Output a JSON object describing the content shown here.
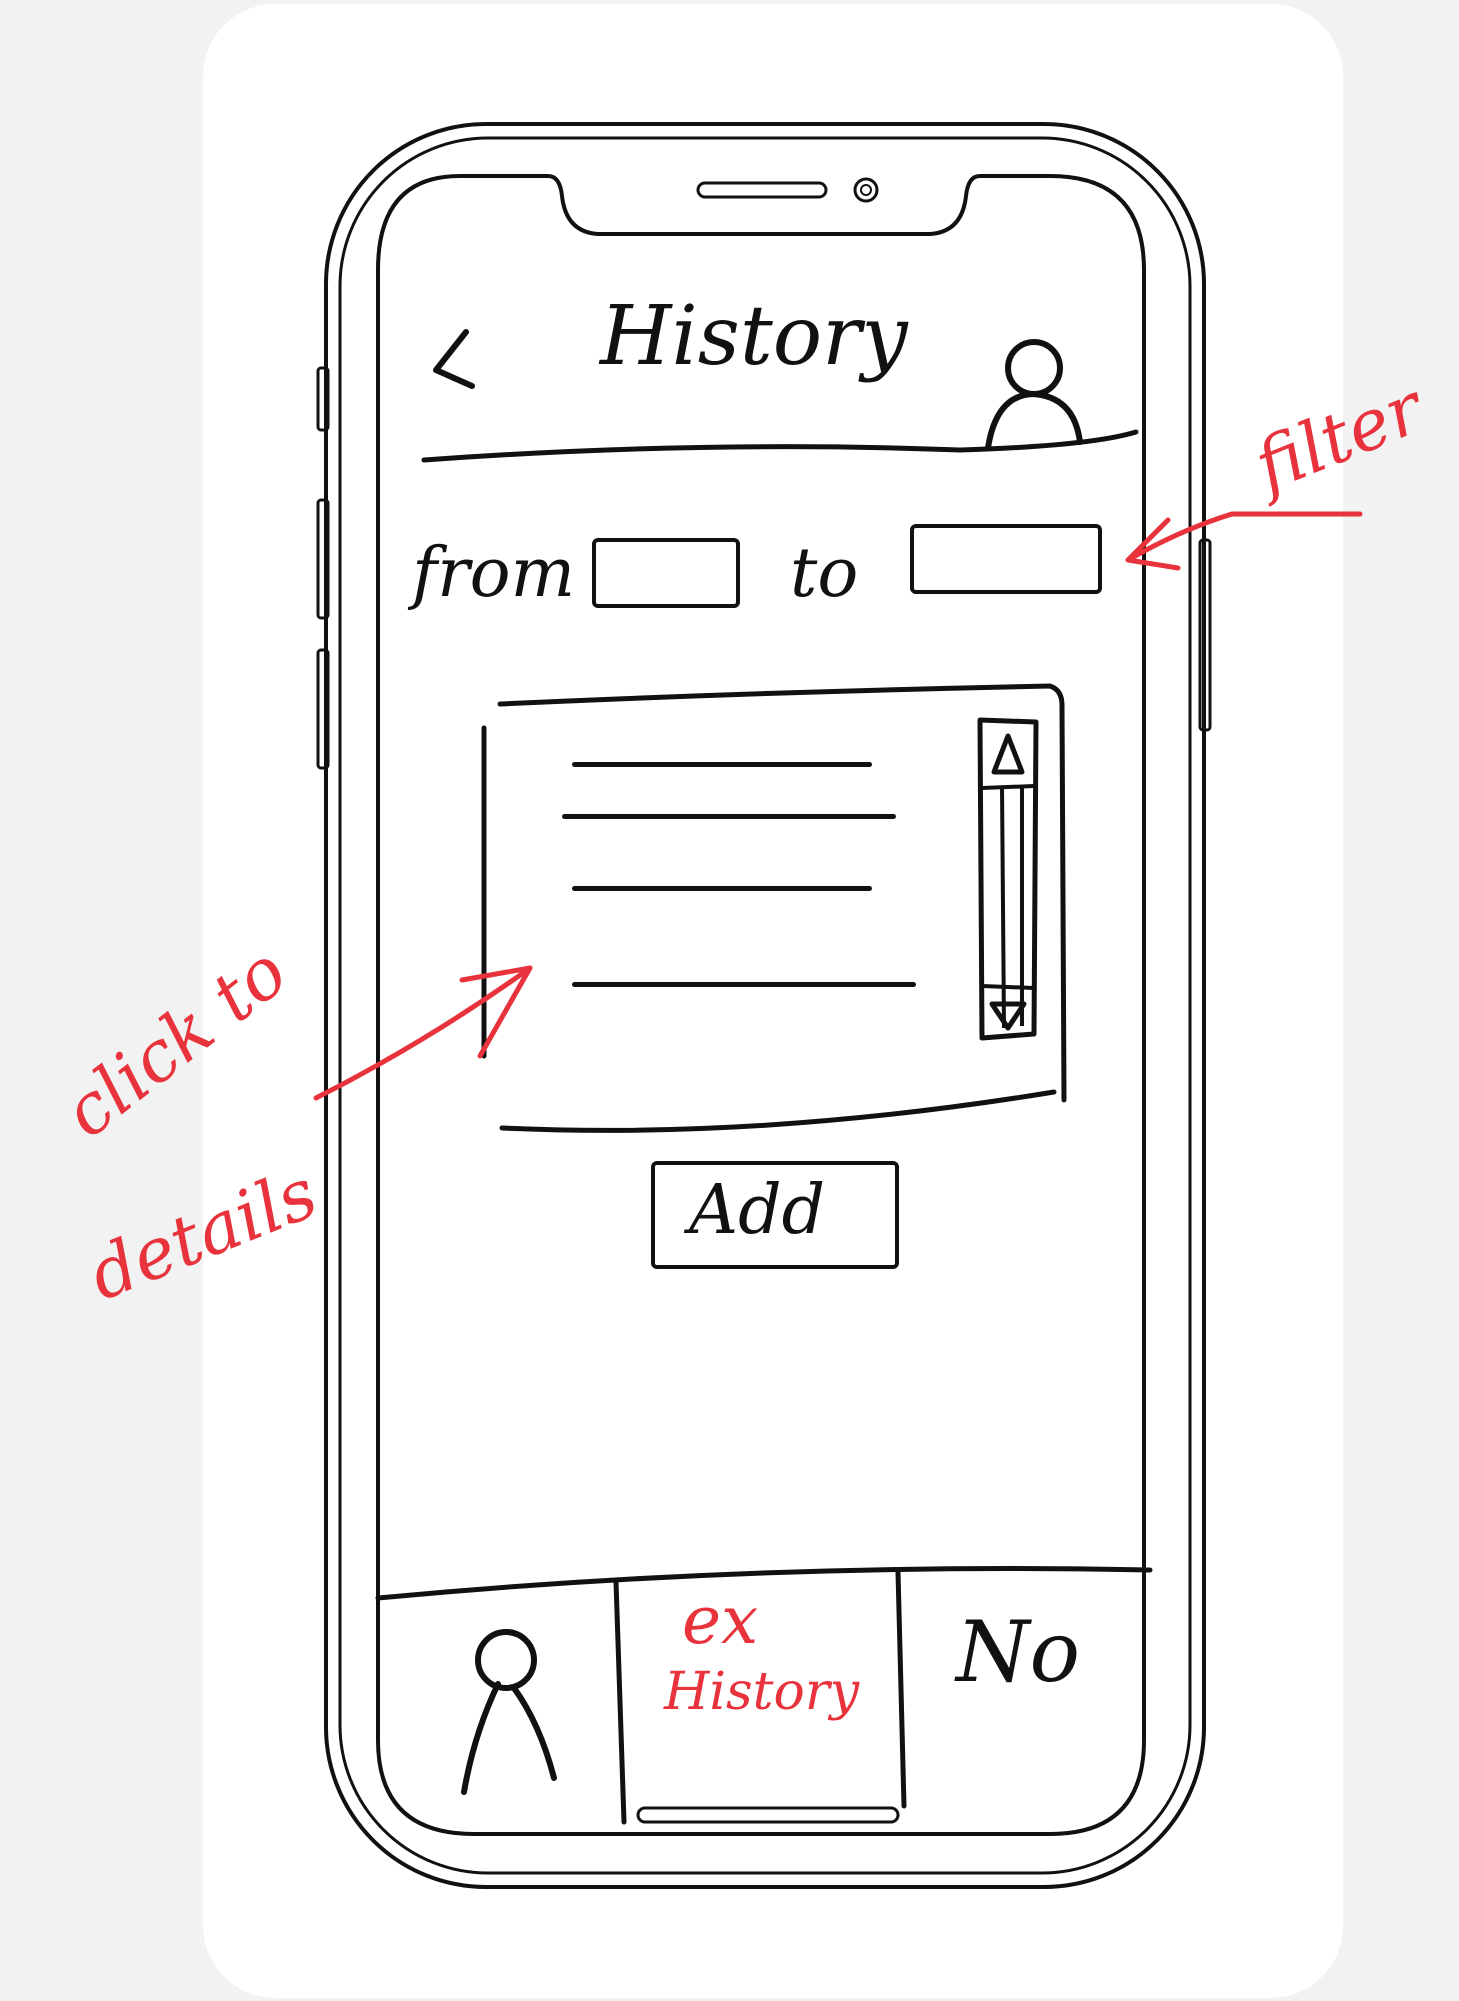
{
  "header": {
    "back_icon": "chevron-left-icon",
    "title": "History",
    "profile_icon": "person-icon"
  },
  "filter": {
    "from_label": "from",
    "to_label": "to",
    "from_value": "",
    "to_value": ""
  },
  "history_list": {
    "items": [
      "",
      "",
      "",
      ""
    ],
    "scroll_up_icon": "triangle-up-icon",
    "scroll_down_icon": "triangle-down-icon"
  },
  "add_button": {
    "label": "Add"
  },
  "bottom_nav": {
    "tabs": [
      {
        "icon": "person-icon",
        "label": ""
      },
      {
        "label": "History",
        "note": "ex"
      },
      {
        "label": "No"
      }
    ]
  },
  "annotations": {
    "filter_note": "filter",
    "list_note_line1": "click to",
    "list_note_line2": "details",
    "annotation_color": "#e8323c"
  }
}
